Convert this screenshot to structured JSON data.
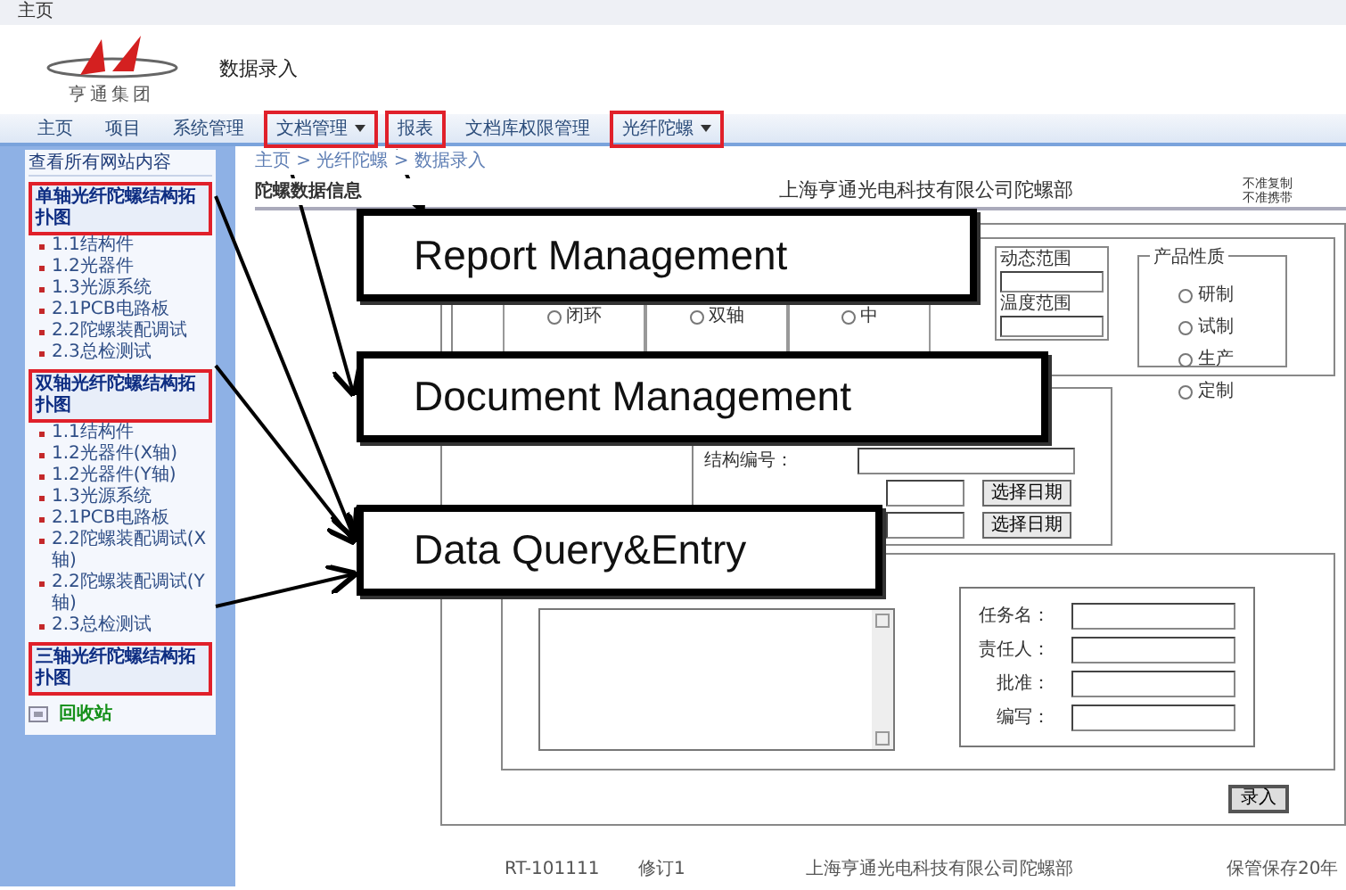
{
  "top_bar": {
    "title": "主页"
  },
  "header": {
    "logo_text": "亨通集团",
    "page_title": "数据录入"
  },
  "nav": [
    {
      "label": "主页",
      "dropdown": false,
      "highlighted": false
    },
    {
      "label": "项目",
      "dropdown": false,
      "highlighted": false
    },
    {
      "label": "系统管理",
      "dropdown": false,
      "highlighted": false
    },
    {
      "label": "文档管理",
      "dropdown": true,
      "highlighted": true
    },
    {
      "label": "报表",
      "dropdown": false,
      "highlighted": true
    },
    {
      "label": "文档库权限管理",
      "dropdown": false,
      "highlighted": false
    },
    {
      "label": "光纤陀螺",
      "dropdown": true,
      "highlighted": true
    }
  ],
  "sidebar": {
    "heading": "查看所有网站内容",
    "groups": [
      {
        "title": "单轴光纤陀螺结构拓扑图",
        "highlighted": true,
        "items": [
          "1.1结构件",
          "1.2光器件",
          "1.3光源系统",
          "2.1PCB电路板",
          "2.2陀螺装配调试",
          "2.3总检测试"
        ]
      },
      {
        "title": "双轴光纤陀螺结构拓扑图",
        "highlighted": true,
        "items": [
          "1.1结构件",
          "1.2光器件(X轴)",
          "1.2光器件(Y轴)",
          "1.3光源系统",
          "2.1PCB电路板",
          "2.2陀螺装配调试(X轴)",
          "2.2陀螺装配调试(Y轴)",
          "2.3总检测试"
        ]
      },
      {
        "title": "三轴光纤陀螺结构拓扑图",
        "highlighted": true
      }
    ],
    "recycle_bin": "回收站"
  },
  "breadcrumb": "主页 > 光纤陀螺 > 数据录入",
  "doc_header": {
    "title": "陀螺数据信息",
    "company": "上海亨通光电科技有限公司陀螺部",
    "notices": [
      "不准复制",
      "不准携带"
    ]
  },
  "form": {
    "radio_options": [
      {
        "label": "闭环",
        "selected": false
      },
      {
        "label": "双轴",
        "selected": false
      },
      {
        "label": "中",
        "selected": false
      }
    ],
    "range_labels": [
      "动态范围",
      "温度范围"
    ],
    "product_nature": {
      "legend": "产品性质",
      "options": [
        {
          "label": "研制",
          "selected": false
        },
        {
          "label": "试制",
          "selected": false
        },
        {
          "label": "生产",
          "selected": false
        },
        {
          "label": "定制",
          "selected": false
        }
      ]
    },
    "structure_label": "结构编号：",
    "date_buttons": [
      "选择日期",
      "选择日期"
    ],
    "task_fields": [
      {
        "label": "任务名："
      },
      {
        "label": "责任人："
      },
      {
        "label": "批准："
      },
      {
        "label": "编写："
      }
    ],
    "submit": "录入"
  },
  "footer": [
    "RT-101111",
    "修订1",
    "上海亨通光电科技有限公司陀螺部",
    "保管保存20年"
  ],
  "callouts": [
    {
      "text": "Report Management"
    },
    {
      "text": "Document Management"
    },
    {
      "text": "Data Query&Entry"
    }
  ]
}
